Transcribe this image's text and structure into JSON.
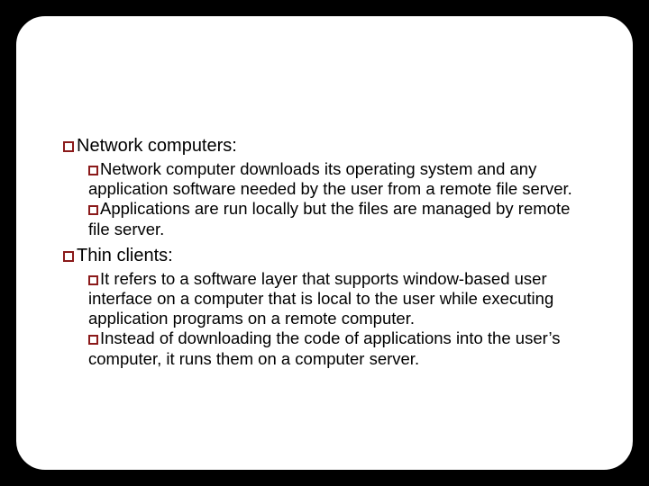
{
  "slide": {
    "sections": [
      {
        "heading": "Network computers:",
        "items": [
          "Network  computer downloads its operating system and any application software needed by the user from a remote file server.",
          "Applications are run locally but the files are managed by remote file server."
        ]
      },
      {
        "heading": "Thin clients:",
        "items": [
          "It refers to a software layer that supports window-based user interface  on a computer that is local to the user while executing application programs on a remote computer.",
          "Instead  of downloading the code of applications into the user’s computer, it runs them on a computer server."
        ]
      }
    ]
  }
}
